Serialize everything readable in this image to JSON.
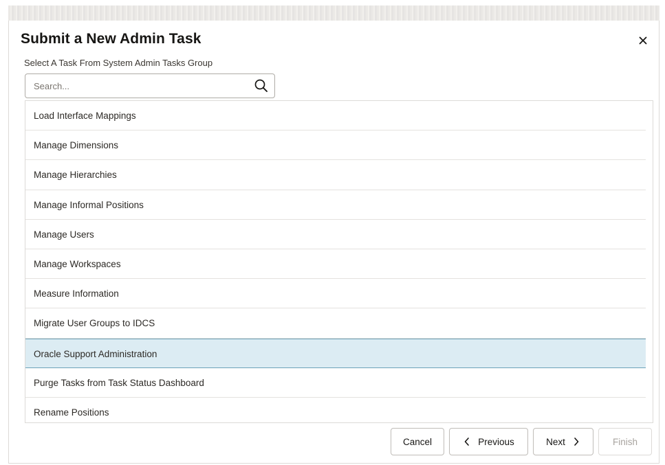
{
  "dialog": {
    "title": "Submit a New Admin Task",
    "close_icon": "close-icon",
    "group_label": "Select A Task From System Admin Tasks Group"
  },
  "search": {
    "placeholder": "Search...",
    "value": "",
    "icon": "search-icon"
  },
  "tasks": {
    "items": [
      {
        "label": "Load Interface Mappings",
        "selected": false
      },
      {
        "label": "Manage Dimensions",
        "selected": false
      },
      {
        "label": "Manage Hierarchies",
        "selected": false
      },
      {
        "label": "Manage Informal Positions",
        "selected": false
      },
      {
        "label": "Manage Users",
        "selected": false
      },
      {
        "label": "Manage Workspaces",
        "selected": false
      },
      {
        "label": "Measure Information",
        "selected": false
      },
      {
        "label": "Migrate User Groups to IDCS",
        "selected": false
      },
      {
        "label": "Oracle Support Administration",
        "selected": true
      },
      {
        "label": "Purge Tasks from Task Status Dashboard",
        "selected": false
      },
      {
        "label": "Rename Positions",
        "selected": false
      }
    ]
  },
  "footer": {
    "cancel_label": "Cancel",
    "previous_label": "Previous",
    "next_label": "Next",
    "finish_label": "Finish",
    "finish_disabled": true
  },
  "colors": {
    "selected_row_bg": "#dcecf3",
    "selected_row_border": "#6aa1b8",
    "text": "#161513",
    "disabled_text": "#a7a39e"
  }
}
